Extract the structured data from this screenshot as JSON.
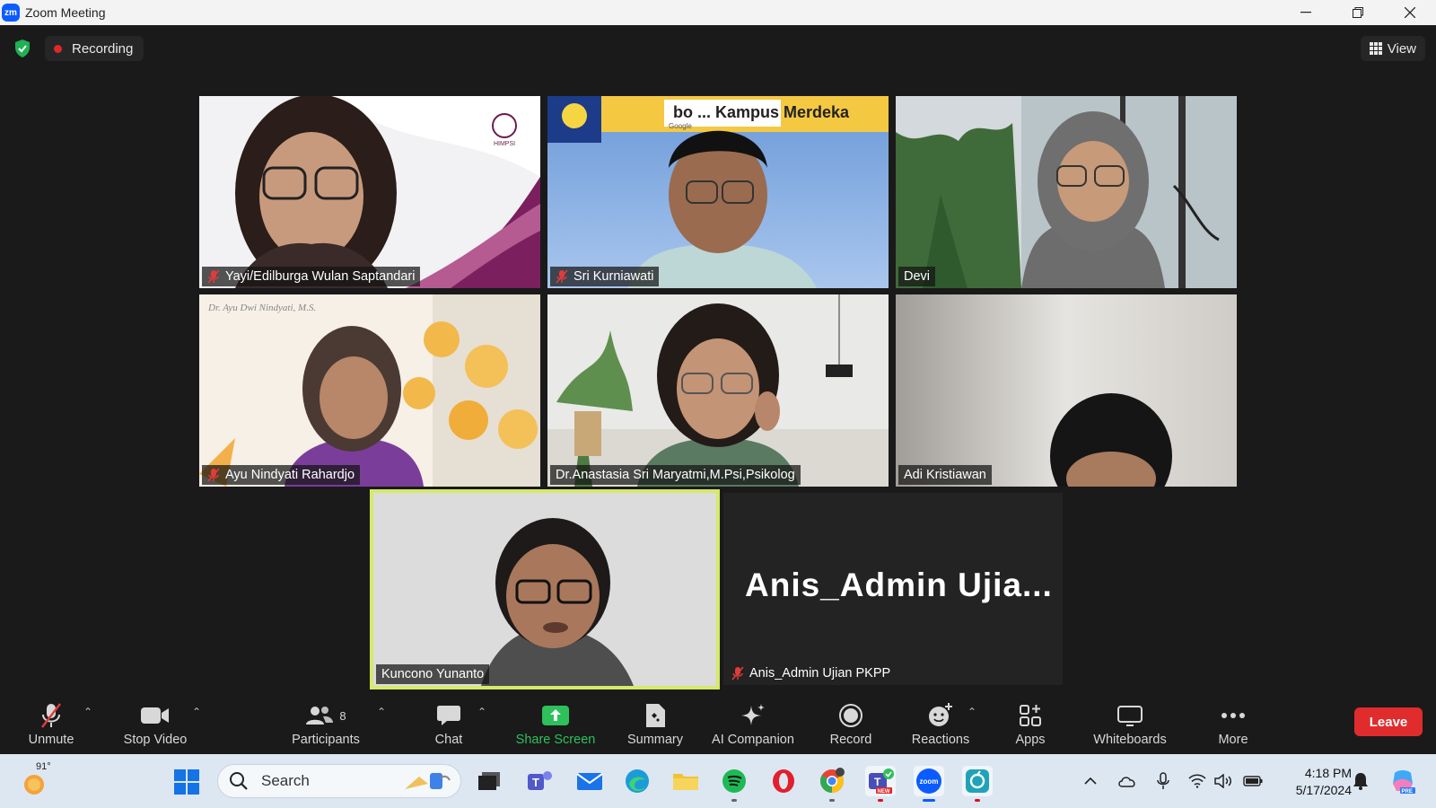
{
  "window": {
    "title": "Zoom Meeting",
    "logo_text": "zm"
  },
  "top_bar": {
    "recording_label": "Recording",
    "view_label": "View"
  },
  "participants": [
    {
      "name": "Yayi/Edilburga Wulan Saptandari",
      "muted": true
    },
    {
      "name": "Sri Kurniawati",
      "muted": true
    },
    {
      "name": "Devi",
      "muted": false
    },
    {
      "name": "Ayu Nindyati Rahardjo",
      "muted": true
    },
    {
      "name": "Dr.Anastasia Sri Maryatmi,M.Psi,Psikolog",
      "muted": false
    },
    {
      "name": "Adi Kristiawan",
      "muted": false
    },
    {
      "name": "Kuncono Yunanto",
      "muted": false,
      "active_speaker": true
    }
  ],
  "no_video_tile": {
    "display_name": "Anis_Admin  Ujia...",
    "name": "Anis_Admin Ujian PKPP",
    "muted": true
  },
  "tile_overlays": {
    "himpsi": "HIMPSI",
    "banner": "bo  ...  Kampus Merdeka",
    "banner_sub": "Google",
    "ayu_script": "Dr. Ayu Dwi Nindyati, M.S."
  },
  "toolbar": {
    "unmute": "Unmute",
    "stop_video": "Stop Video",
    "participants": "Participants",
    "participants_count": "8",
    "chat": "Chat",
    "share_screen": "Share Screen",
    "summary": "Summary",
    "ai_companion": "AI Companion",
    "record": "Record",
    "reactions": "Reactions",
    "apps": "Apps",
    "whiteboards": "Whiteboards",
    "more": "More",
    "leave": "Leave"
  },
  "taskbar": {
    "weather_temp": "91°",
    "search_placeholder": "Search",
    "time": "4:18 PM",
    "date": "5/17/2024",
    "teams_badge": "NEW",
    "zoom_label": "zoom",
    "copilot_badge": "PRE"
  },
  "colors": {
    "accent_green": "#2ec05a",
    "leave_red": "#e02c2c",
    "speaker_border": "#d7e86a",
    "zoom_blue": "#0b5cff"
  }
}
